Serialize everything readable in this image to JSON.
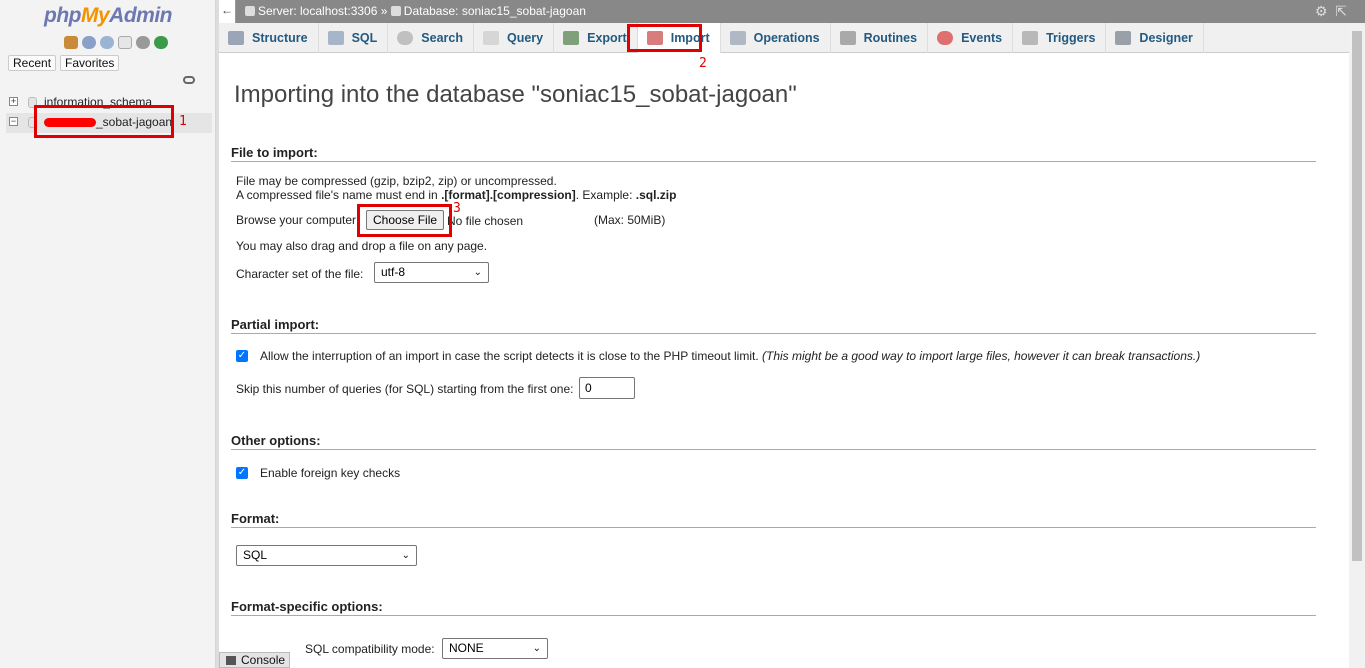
{
  "logo": {
    "php": "php",
    "my": "My",
    "admin": "Admin"
  },
  "nav": {
    "recent_label": "Recent",
    "favorites_label": "Favorites",
    "databases": [
      {
        "name": "information_schema"
      },
      {
        "name": "_sobat-jagoan"
      }
    ]
  },
  "topbar": {
    "server": "Server: localhost:3306",
    "separator": "»",
    "database": "Database: soniac15_sobat-jagoan"
  },
  "tabs": [
    {
      "label": "Structure",
      "icon": "structure-icon"
    },
    {
      "label": "SQL",
      "icon": "sql-icon"
    },
    {
      "label": "Search",
      "icon": "search-icon"
    },
    {
      "label": "Query",
      "icon": "query-icon"
    },
    {
      "label": "Export",
      "icon": "export-icon"
    },
    {
      "label": "Import",
      "icon": "import-icon"
    },
    {
      "label": "Operations",
      "icon": "operations-icon"
    },
    {
      "label": "Routines",
      "icon": "routines-icon"
    },
    {
      "label": "Events",
      "icon": "events-icon"
    },
    {
      "label": "Triggers",
      "icon": "triggers-icon"
    },
    {
      "label": "Designer",
      "icon": "designer-icon"
    }
  ],
  "annotations": {
    "one": "1",
    "two": "2",
    "three": "3"
  },
  "main": {
    "title": "Importing into the database \"soniac15_sobat-jagoan\"",
    "file_to_import": {
      "heading": "File to import:",
      "line1": "File may be compressed (gzip, bzip2, zip) or uncompressed.",
      "line2_pre": "A compressed file's name must end in ",
      "line2_bold": ".[format].[compression]",
      "line2_mid": ". Example: ",
      "line2_ext": ".sql.zip",
      "browse_label": "Browse your computer:",
      "choose_file": "Choose File",
      "no_file": "No file chosen",
      "max": "(Max: 50MiB)",
      "drag_hint": "You may also drag and drop a file on any page.",
      "charset_label": "Character set of the file:",
      "charset_value": "utf-8"
    },
    "partial_import": {
      "heading": "Partial import:",
      "allow_interrupt": "Allow the interruption of an import in case the script detects it is close to the PHP timeout limit.",
      "allow_interrupt_note": "(This might be a good way to import large files, however it can break transactions.)",
      "allow_interrupt_checked": true,
      "skip_label": "Skip this number of queries (for SQL) starting from the first one:",
      "skip_value": "0"
    },
    "other_options": {
      "heading": "Other options:",
      "fk_checks": "Enable foreign key checks",
      "fk_checked": true
    },
    "format": {
      "heading": "Format:",
      "value": "SQL"
    },
    "format_specific": {
      "heading": "Format-specific options:",
      "compat_label": "SQL compatibility mode:",
      "compat_value": "NONE"
    }
  },
  "console": {
    "label": "Console"
  }
}
